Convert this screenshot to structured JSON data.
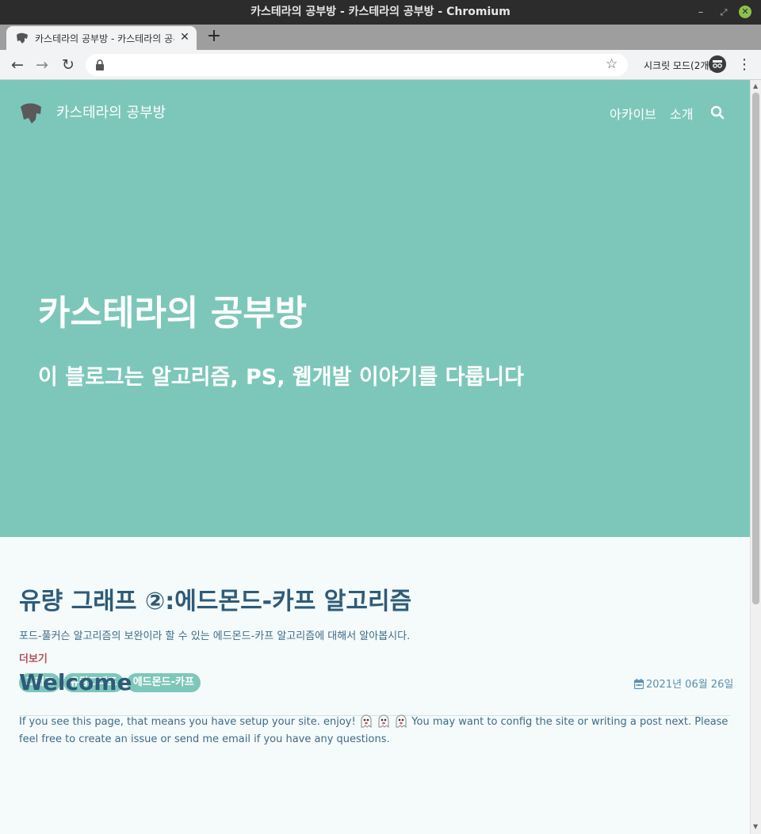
{
  "window": {
    "title": "카스테라의 공부방 - 카스테라의 공부방 - Chromium",
    "controls": {
      "minimize": "–",
      "maximize": "⤢",
      "close": "✕"
    }
  },
  "tabs": [
    {
      "title": "카스테라의 공부방 - 카스테라의 공부방",
      "close": "✕"
    }
  ],
  "new_tab_label": "+",
  "toolbar": {
    "back": "←",
    "forward": "→",
    "reload": "↻",
    "address": "",
    "bookmark": "☆",
    "incognito_label": "시크릿 모드(2개)",
    "menu": "⋮"
  },
  "site": {
    "name": "카스테라의 공부방",
    "nav": [
      {
        "label": "아카이브"
      },
      {
        "label": "소개"
      }
    ],
    "hero_title": "카스테라의 공부방",
    "hero_subtitle": "이 블로그는 알고리즘, PS, 웹개발 이야기를 다룹니다",
    "colors": {
      "hero_bg": "#7dc7ba",
      "title_text": "#2e5b78",
      "more_link": "#b0505e",
      "tag_bg": "#7dc7ba"
    }
  },
  "post": {
    "title": "유량 그래프 ②:에드몬드-카프 알고리즘",
    "excerpt": "포드-풀커슨 알고리즘의 보완이라 할 수 있는 에드몬드-카프 알고리즘에 대해서 알아봅시다.",
    "more": "더보기",
    "tags": [
      "그래프",
      "유량그래프",
      "에드몬드-카프"
    ],
    "date": "2021년 06월 26일"
  },
  "welcome": {
    "title": "Welcome",
    "text_before": "If you see this page, that means you have setup your site. enjoy!",
    "text_after": "You may want to config the site or writing a post next. Please feel free to create an issue or send me email if you have any questions."
  },
  "icons": [
    "leaf-logo-icon",
    "lock-icon",
    "star-icon",
    "incognito-icon",
    "search-icon",
    "calendar-icon",
    "ghost-icon"
  ]
}
